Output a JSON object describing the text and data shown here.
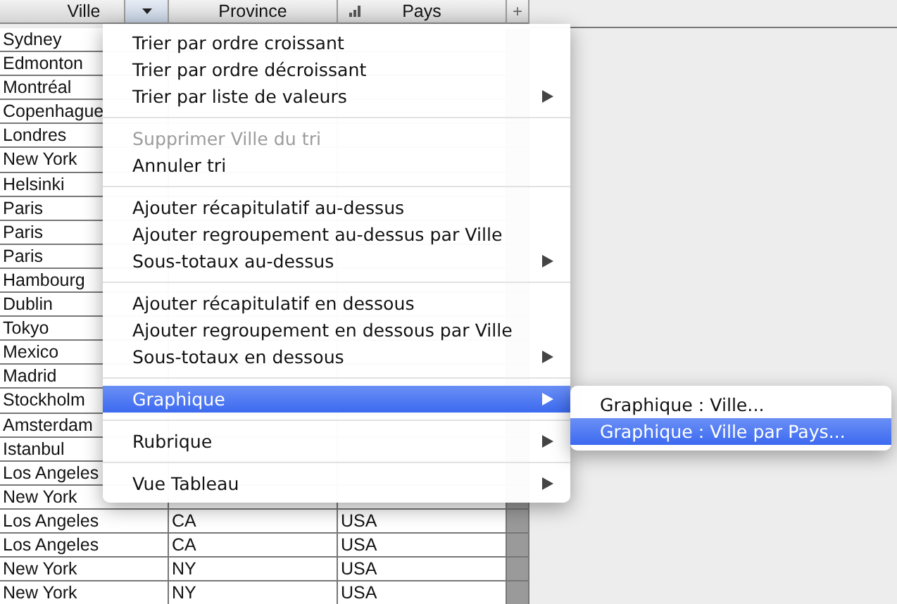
{
  "table": {
    "columns": [
      {
        "label": "Ville",
        "kind": "dropdown"
      },
      {
        "label": "Province",
        "kind": "plain"
      },
      {
        "label": "Pays",
        "kind": "chart"
      }
    ],
    "add_column": "+",
    "rows": [
      {
        "cells": [
          "Sydney"
        ]
      },
      {
        "cells": [
          "Edmonton"
        ]
      },
      {
        "cells": [
          "Montréal"
        ]
      },
      {
        "cells": [
          "Copenhague"
        ]
      },
      {
        "cells": [
          "Londres"
        ]
      },
      {
        "cells": [
          "New York"
        ]
      },
      {
        "cells": [
          "Helsinki"
        ]
      },
      {
        "cells": [
          "Paris"
        ]
      },
      {
        "cells": [
          "Paris"
        ]
      },
      {
        "cells": [
          "Paris"
        ]
      },
      {
        "cells": [
          "Hambourg"
        ]
      },
      {
        "cells": [
          "Dublin"
        ]
      },
      {
        "cells": [
          "Tokyo"
        ]
      },
      {
        "cells": [
          "Mexico"
        ]
      },
      {
        "cells": [
          "Madrid"
        ]
      },
      {
        "cells": [
          "Stockholm"
        ]
      },
      {
        "cells": [
          "Amsterdam"
        ]
      },
      {
        "cells": [
          "Istanbul"
        ]
      },
      {
        "cells": [
          "Los Angeles"
        ]
      },
      {
        "cells": [
          "New York"
        ]
      },
      {
        "cells": [
          "Los Angeles",
          "CA",
          "USA"
        ]
      },
      {
        "cells": [
          "Los Angeles",
          "CA",
          "USA"
        ]
      },
      {
        "cells": [
          "New York",
          "NY",
          "USA"
        ]
      },
      {
        "cells": [
          "New York",
          "NY",
          "USA"
        ]
      }
    ]
  },
  "menu": {
    "groups": [
      [
        {
          "label": "Trier par ordre croissant",
          "kind": "action",
          "disabled": false,
          "selected": false
        },
        {
          "label": "Trier par ordre décroissant",
          "kind": "action",
          "disabled": false,
          "selected": false
        },
        {
          "label": "Trier par liste de valeurs",
          "kind": "submenu",
          "disabled": false,
          "selected": false
        }
      ],
      [
        {
          "label": "Supprimer Ville du tri",
          "kind": "action",
          "disabled": true,
          "selected": false
        },
        {
          "label": "Annuler tri",
          "kind": "action",
          "disabled": false,
          "selected": false
        }
      ],
      [
        {
          "label": "Ajouter récapitulatif au-dessus",
          "kind": "action",
          "disabled": false,
          "selected": false
        },
        {
          "label": "Ajouter regroupement au-dessus par Ville",
          "kind": "action",
          "disabled": false,
          "selected": false
        },
        {
          "label": "Sous-totaux au-dessus",
          "kind": "submenu",
          "disabled": false,
          "selected": false
        }
      ],
      [
        {
          "label": "Ajouter récapitulatif en dessous",
          "kind": "action",
          "disabled": false,
          "selected": false
        },
        {
          "label": "Ajouter regroupement en dessous par Ville",
          "kind": "action",
          "disabled": false,
          "selected": false
        },
        {
          "label": "Sous-totaux en dessous",
          "kind": "submenu",
          "disabled": false,
          "selected": false
        }
      ],
      [
        {
          "label": "Graphique",
          "kind": "submenu",
          "disabled": false,
          "selected": true
        }
      ],
      [
        {
          "label": "Rubrique",
          "kind": "submenu",
          "disabled": false,
          "selected": false
        }
      ],
      [
        {
          "label": "Vue Tableau",
          "kind": "submenu",
          "disabled": false,
          "selected": false
        }
      ]
    ]
  },
  "submenu": {
    "items": [
      {
        "label": "Graphique : Ville...",
        "selected": false
      },
      {
        "label": "Graphique : Ville par Pays...",
        "selected": true
      }
    ]
  }
}
